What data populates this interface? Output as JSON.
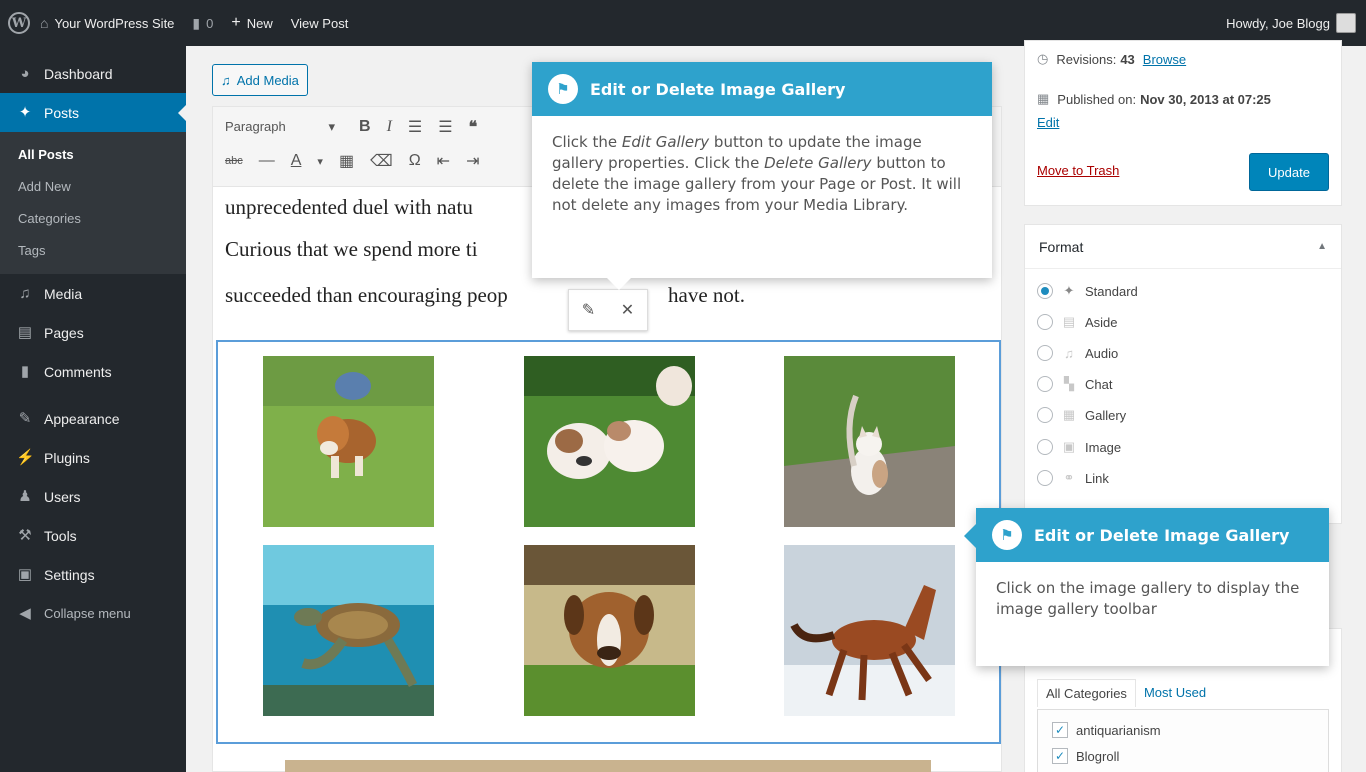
{
  "adminbar": {
    "wp_logo": "W",
    "home_icon": "home-icon",
    "site_name": "Your WordPress Site",
    "comments_count": "0",
    "new_label": "New",
    "view_post_label": "View Post",
    "howdy": "Howdy, Joe Blogg"
  },
  "sidebar": {
    "dashboard": "Dashboard",
    "posts": "Posts",
    "posts_sub": [
      "All Posts",
      "Add New",
      "Categories",
      "Tags"
    ],
    "media": "Media",
    "pages": "Pages",
    "comments": "Comments",
    "appearance": "Appearance",
    "plugins": "Plugins",
    "users": "Users",
    "tools": "Tools",
    "settings": "Settings",
    "collapse": "Collapse menu"
  },
  "editor": {
    "add_media": "Add Media",
    "format_select": "Paragraph",
    "paragraphs": [
      "unprecedented duel with natu",
      "Curious that we spend more ti",
      "succeeded than encouraging peop",
      "have not."
    ]
  },
  "publish": {
    "revisions_label": "Revisions:",
    "revisions_count": "43",
    "browse": "Browse",
    "published_label": "Published on:",
    "published_date": "Nov 30, 2013 at 07:25",
    "edit": "Edit",
    "trash": "Move to Trash",
    "update": "Update"
  },
  "format": {
    "title": "Format",
    "options": [
      "Standard",
      "Aside",
      "Audio",
      "Chat",
      "Gallery",
      "Image",
      "Link"
    ],
    "selected": "Standard"
  },
  "categories": {
    "tab_all": "All Categories",
    "tab_used": "Most Used",
    "items": [
      "antiquarianism",
      "Blogroll"
    ]
  },
  "pointer1": {
    "title": "Edit or Delete Image Gallery",
    "body_pre": "Click the ",
    "body_em1": "Edit Gallery",
    "body_mid": " button to update the image gallery properties. Click the ",
    "body_em2": "Delete Gallery",
    "body_post": " button to delete the image gallery from your Page or Post. It will not delete any images from your Media Library."
  },
  "pointer2": {
    "title": "Edit or Delete Image Gallery",
    "body": "Click on the image gallery to display the image gallery toolbar"
  },
  "colors": {
    "admin_dark": "#23282d",
    "accent": "#0073aa",
    "pointer_blue": "#2ea2cc"
  }
}
